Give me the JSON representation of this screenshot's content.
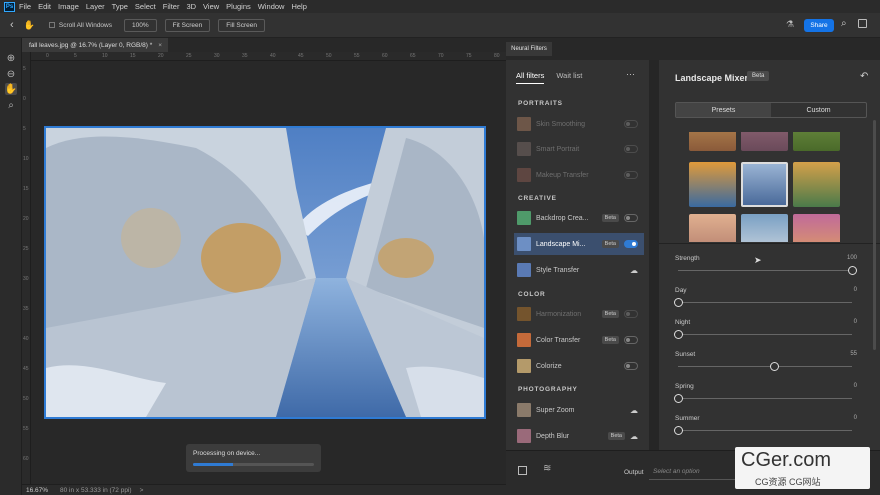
{
  "menu": {
    "logo": "Ps",
    "items": [
      "File",
      "Edit",
      "Image",
      "Layer",
      "Type",
      "Select",
      "Filter",
      "3D",
      "View",
      "Plugins",
      "Window",
      "Help"
    ]
  },
  "options": {
    "scroll_all": "Scroll All Windows",
    "zoom_pct": "100%",
    "fit_screen": "Fit Screen",
    "fill_screen": "Fill Screen",
    "share": "Share"
  },
  "document": {
    "tab_title": "fall leaves.jpg @ 16.7% (Layer 0, RGB/8) *",
    "close": "×",
    "ruler_top": [
      "0",
      "5",
      "10",
      "15",
      "20",
      "25",
      "30",
      "35",
      "40",
      "45",
      "50",
      "55",
      "60",
      "65",
      "70",
      "75",
      "80"
    ],
    "ruler_left": [
      "5",
      "0",
      "5",
      "10",
      "15",
      "20",
      "25",
      "30",
      "35",
      "40",
      "45",
      "50",
      "55",
      "60"
    ]
  },
  "progress": {
    "text": "Processing on device...",
    "value": 0.33
  },
  "status": {
    "zoom": "16.67%",
    "dims": "80 in x 53.333 in (72 ppi)",
    "arrow": ">"
  },
  "neural": {
    "panel_tab": "Neural Filters",
    "tabs": {
      "all": "All filters",
      "wait": "Wait list",
      "more": "···"
    },
    "sections": {
      "portraits": "PORTRAITS",
      "creative": "CREATIVE",
      "color": "COLOR",
      "photography": "PHOTOGRAPHY"
    },
    "filters": {
      "skin": "Skin Smoothing",
      "smart": "Smart Portrait",
      "makeup": "Makeup Transfer",
      "backdrop": "Backdrop Crea...",
      "landscape": "Landscape Mi...",
      "style": "Style Transfer",
      "harmonization": "Harmonization",
      "colortransfer": "Color Transfer",
      "colorize": "Colorize",
      "superzoom": "Super Zoom",
      "depthblur": "Depth Blur"
    },
    "beta": "Beta"
  },
  "mixer": {
    "title": "Landscape Mixer",
    "beta": "Beta",
    "presets": "Presets",
    "custom": "Custom",
    "sliders": [
      {
        "label": "Strength",
        "value": "100",
        "pos": 1.0
      },
      {
        "label": "Day",
        "value": "0",
        "pos": 0.0
      },
      {
        "label": "Night",
        "value": "0",
        "pos": 0.0
      },
      {
        "label": "Sunset",
        "value": "55",
        "pos": 0.55
      },
      {
        "label": "Spring",
        "value": "0",
        "pos": 0.0
      },
      {
        "label": "Summer",
        "value": "0",
        "pos": 0.0
      }
    ]
  },
  "output": {
    "label": "Output",
    "placeholder": "Select an option"
  },
  "watermark": {
    "main": "CGer.com",
    "sub": "CG资源 CG网站"
  }
}
